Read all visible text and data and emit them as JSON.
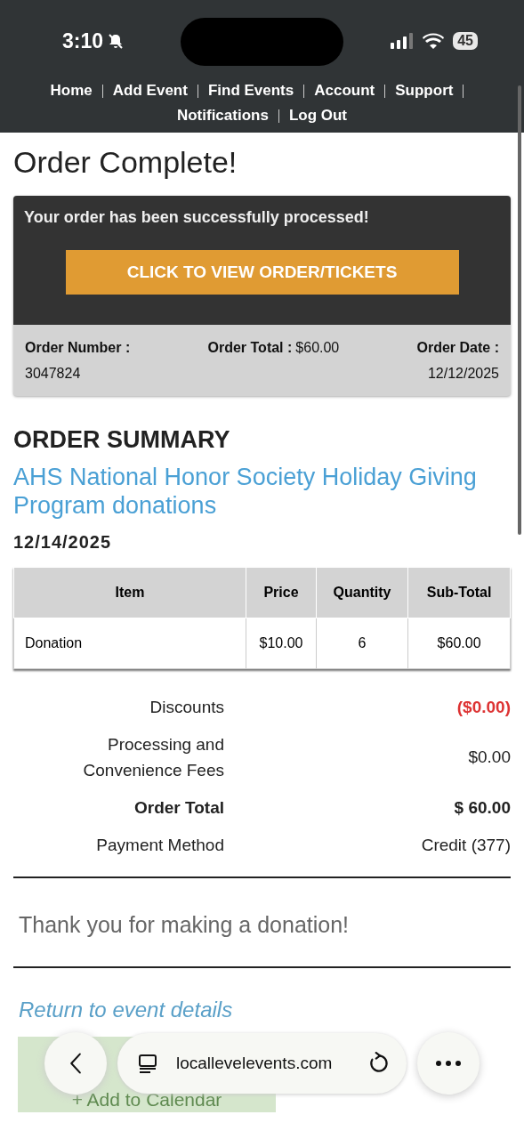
{
  "status_bar": {
    "time": "3:10",
    "battery": "45"
  },
  "nav": {
    "items": [
      "Home",
      "Add Event",
      "Find Events",
      "Account",
      "Support",
      "Notifications",
      "Log Out"
    ]
  },
  "title": "Order Complete!",
  "confirmation": {
    "message": "Your order has been successfully processed!",
    "button": "CLICK TO VIEW ORDER/TICKETS",
    "order_number_label": "Order Number :",
    "order_number": "3047824",
    "order_total_label": "Order Total :",
    "order_total": "$60.00",
    "order_date_label": "Order Date :",
    "order_date": "12/12/2025"
  },
  "summary": {
    "heading": "ORDER SUMMARY",
    "event_title": "AHS National Honor Society Holiday Giving Program donations",
    "event_date": "12/14/2025"
  },
  "table": {
    "columns": [
      "Item",
      "Price",
      "Quantity",
      "Sub-Total"
    ],
    "rows": [
      [
        "Donation",
        "$10.00",
        "6",
        "$60.00"
      ]
    ]
  },
  "totals": [
    {
      "kind": "normal",
      "label": "Discounts",
      "value": "($0.00)",
      "negative": true
    },
    {
      "kind": "normal",
      "label": "Processing and Convenience Fees",
      "value": "$0.00",
      "negative": false
    },
    {
      "kind": "bold",
      "label": "Order Total",
      "value": "$ 60.00",
      "negative": false
    },
    {
      "kind": "normal",
      "label": "Payment Method",
      "value": "Credit (377)",
      "negative": false
    }
  ],
  "thank_you": "Thank you for making a donation!",
  "return_link": "Return to event details",
  "calendar_button": "+ Add to Calendar",
  "browser": {
    "url": "locallevelevents.com"
  }
}
